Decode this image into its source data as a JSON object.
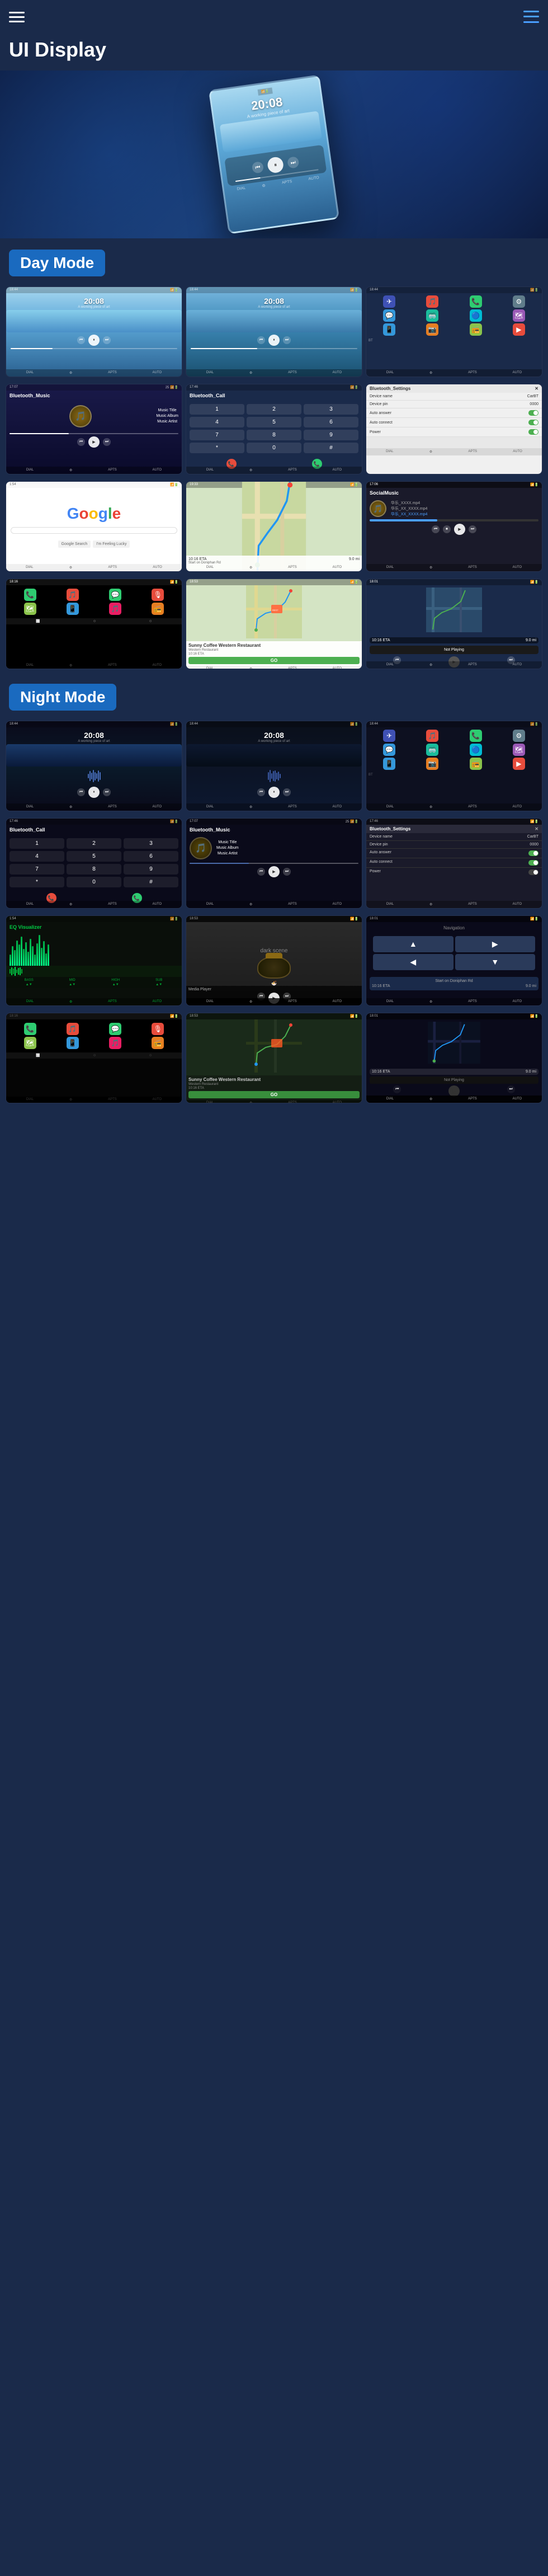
{
  "header": {
    "title": "UI Display",
    "hamburger_label": "menu",
    "nav_icon": "navigation"
  },
  "hero": {
    "time": "20:08",
    "subtitle": "A working piece of art"
  },
  "modes": {
    "day": "Day Mode",
    "night": "Night Mode"
  },
  "music": {
    "title": "Music Title",
    "album": "Music Album",
    "artist": "Music Artist"
  },
  "navigation": {
    "eta": "10:16 ETA",
    "distance": "9.0 mi",
    "time_remaining": "19:16 ETA",
    "instruction": "Start on Doniphan Rd",
    "go_button": "GO",
    "not_playing": "Not Playing"
  },
  "restaurant": {
    "name": "Sunny Coffee Western Restaurant",
    "address": "Western Restaurant"
  },
  "settings": {
    "device_name_label": "Device name",
    "device_name_value": "CarBT",
    "device_pin_label": "Device pin",
    "device_pin_value": "0000",
    "auto_answer_label": "Auto answer",
    "auto_connect_label": "Auto connect",
    "power_label": "Power"
  },
  "call": {
    "keys": [
      "1",
      "2",
      "3",
      "4",
      "5",
      "6",
      "7",
      "8",
      "9",
      "*",
      "0",
      "#"
    ]
  },
  "icons": {
    "app_colors": [
      "#2ecc71",
      "#e74c3c",
      "#3498db",
      "#e67e22",
      "#9b59b6",
      "#1abc9c",
      "#e91e63",
      "#f1c40f",
      "#3f51b5",
      "#00bcd4",
      "#8bc34a",
      "#795548"
    ],
    "app_emojis": [
      "📞",
      "🎵",
      "🗺",
      "⚙",
      "📱",
      "📷",
      "🔵",
      "🎙",
      "📻",
      "🔷",
      "⭐",
      "🔧"
    ]
  },
  "time_displays": {
    "main": "20:08",
    "status_left": "18:16",
    "status_right": "25",
    "small_time": "17:07"
  }
}
